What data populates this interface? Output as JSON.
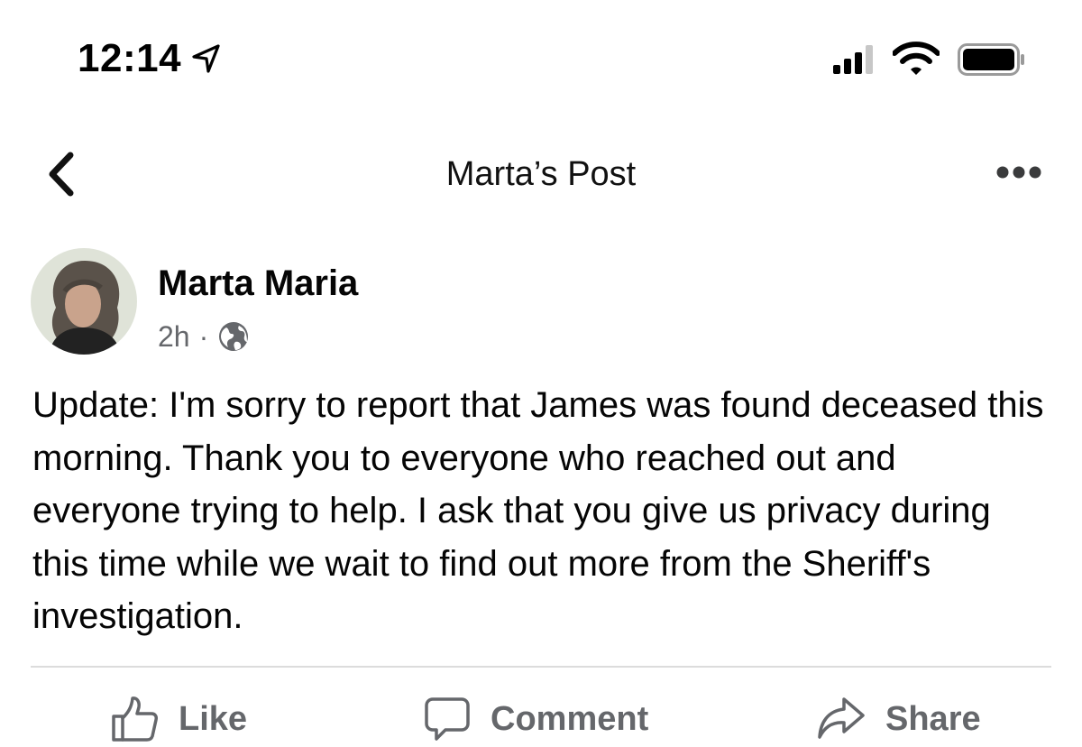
{
  "status_bar": {
    "time": "12:14",
    "location_icon": "location-arrow-icon",
    "signal_icon": "cellular-signal-icon",
    "wifi_icon": "wifi-icon",
    "battery_icon": "battery-icon"
  },
  "nav": {
    "title": "Marta’s Post",
    "back_icon": "chevron-left-icon",
    "more_icon": "more-horizontal-icon"
  },
  "post": {
    "author": "Marta Maria",
    "time": "2h",
    "separator": "·",
    "audience_icon": "globe-icon",
    "body": "Update: I'm sorry to report that James was found deceased this morning. Thank you to everyone who reached out and everyone trying to help. I ask that you give us privacy during this time while we wait to find out more from the Sheriff's investigation."
  },
  "actions": {
    "like": "Like",
    "comment": "Comment",
    "share": "Share"
  },
  "colors": {
    "text": "#050505",
    "secondary_text": "#65676b",
    "divider": "#dcdcdc"
  }
}
